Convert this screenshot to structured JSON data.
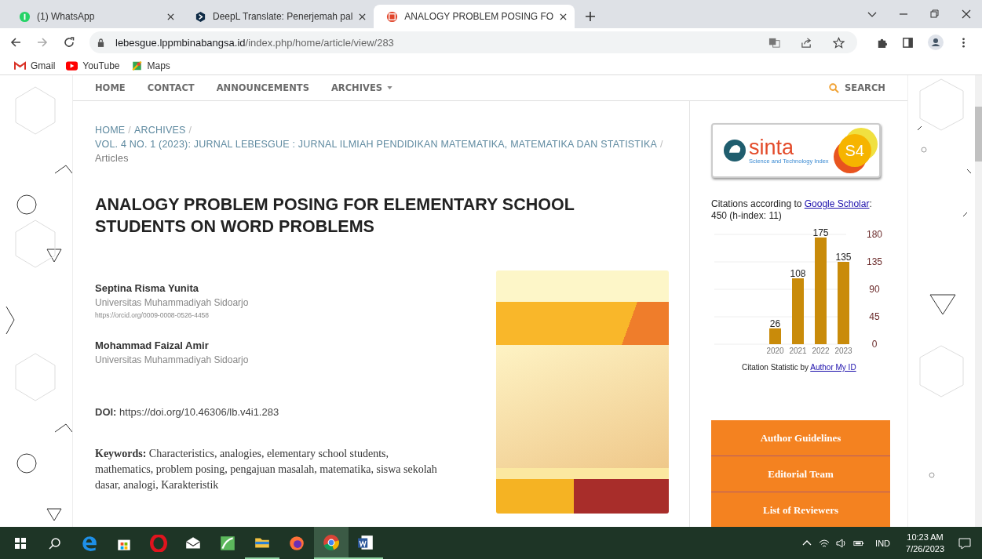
{
  "browser": {
    "tabs": [
      {
        "kind": "chat",
        "title": "(1) WhatsApp",
        "selected": false
      },
      {
        "kind": "translate",
        "title": "DeepL Translate: Penerjemah pal",
        "selected": false
      },
      {
        "kind": "journal",
        "title": "ANALOGY PROBLEM POSING FO",
        "selected": true
      }
    ],
    "url_host": "lebesgue.lppmbinabangsa.id",
    "url_path": "/index.php/home/article/view/283",
    "bookmarks": [
      {
        "kind": "mail",
        "label": "Gmail"
      },
      {
        "kind": "video",
        "label": "YouTube"
      },
      {
        "kind": "map",
        "label": "Maps"
      }
    ]
  },
  "nav": {
    "items": [
      {
        "label": "HOME",
        "dropdown": false
      },
      {
        "label": "CONTACT",
        "dropdown": false
      },
      {
        "label": "ANNOUNCEMENTS",
        "dropdown": false
      },
      {
        "label": "ARCHIVES",
        "dropdown": true
      }
    ],
    "search": "SEARCH"
  },
  "breadcrumb": [
    {
      "label": "HOME",
      "link": true,
      "separator": "/"
    },
    {
      "label": "ARCHIVES",
      "link": true,
      "separator": "/"
    },
    {
      "label": "VOL. 4 NO. 1 (2023): JURNAL LEBESGUE : JURNAL ILMIAH PENDIDIKAN MATEMATIKA, MATEMATIKA DAN STATISTIKA",
      "link": true,
      "separator": "/"
    },
    {
      "label": "Articles",
      "link": false
    }
  ],
  "article": {
    "title": "ANALOGY PROBLEM POSING FOR ELEMENTARY SCHOOL STUDENTS ON WORD PROBLEMS",
    "authors": [
      {
        "name": "Septina Risma Yunita",
        "affiliation": "Universitas Muhammadiyah Sidoarjo",
        "orcid": "https://orcid.org/0009-0008-0526-4458"
      },
      {
        "name": "Mohammad Faizal Amir",
        "affiliation": "Universitas Muhammadiyah Sidoarjo"
      }
    ],
    "doi": "**DOI:** https://doi.org/10.46306/lb.v4i1.283",
    "keywords": "**Keywords:** Characteristics, analogies, elementary school students, mathematics, problem posing, pengajuan masalah, matematika, siswa sekolah dasar, analogi, Karakteristik"
  },
  "sidebar": {
    "sinta": {
      "name": "sinta",
      "subtitle": "Science and Technology Index",
      "grade": "S4"
    },
    "citations": {
      "before": "Citations according to ",
      "link": "Google Scholar",
      "after": ":",
      "summary": "450 (h-index: 11)"
    },
    "chart_data": {
      "type": "bar",
      "categories": [
        "2020",
        "2021",
        "2022",
        "2023"
      ],
      "values": [
        26,
        108,
        175,
        135
      ],
      "yticks": [
        0,
        45,
        90,
        135,
        180
      ],
      "ylim": [
        0,
        180
      ],
      "grid": true,
      "data_labels": true
    },
    "credit": {
      "text": "Citation Statistic by ",
      "link": "Author My ID"
    },
    "menu": [
      "Author Guidelines",
      "Editorial Team",
      "List of Reviewers"
    ]
  },
  "taskbar": {
    "apps": [
      {
        "kind": "edge",
        "running": false,
        "selected": false
      },
      {
        "kind": "store",
        "running": false,
        "selected": false
      },
      {
        "kind": "opera",
        "running": false,
        "selected": false
      },
      {
        "kind": "mail",
        "running": false,
        "selected": false
      },
      {
        "kind": "leaf",
        "running": false,
        "selected": false
      },
      {
        "kind": "folder",
        "running": true,
        "selected": false
      },
      {
        "kind": "firefox",
        "running": false,
        "selected": false
      },
      {
        "kind": "chrome",
        "running": true,
        "selected": true
      },
      {
        "kind": "word",
        "running": true,
        "selected": false
      }
    ],
    "language": "IND",
    "time": "10:23 AM",
    "date": "7/26/2023"
  }
}
